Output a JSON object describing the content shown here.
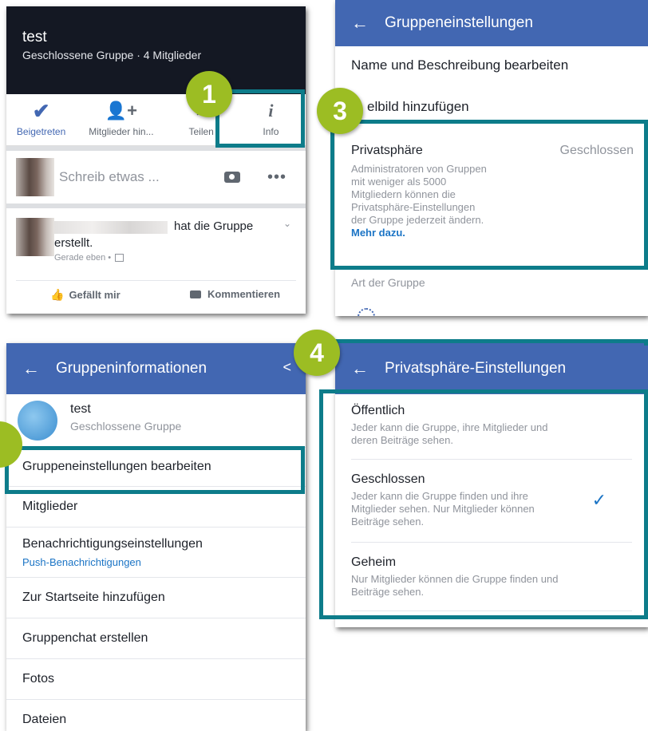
{
  "p1": {
    "group_name": "test",
    "group_sub": "Geschlossene Gruppe · 4 Mitglieder",
    "actions": [
      {
        "label": "Beigetreten",
        "icon": "checkmark-icon"
      },
      {
        "label": "Mitglieder hin...",
        "icon": "add-member-icon"
      },
      {
        "label": "Teilen",
        "icon": "share-icon"
      },
      {
        "label": "Info",
        "icon": "info-icon"
      }
    ],
    "composer_placeholder": "Schreib etwas ...",
    "post_text": "hat die Gruppe",
    "post_text2": "erstellt.",
    "post_time": "Gerade eben •",
    "like": "Gefällt mir",
    "comment": "Kommentieren"
  },
  "p2": {
    "title": "Gruppeneinstellungen",
    "item1": "Name und Beschreibung bearbeiten",
    "item2": "elbild hinzufügen",
    "privacy_label": "Privatsphäre",
    "privacy_value": "Geschlossen",
    "privacy_desc_lines": [
      "Administratoren von Gruppen",
      "mit weniger als 5000",
      "Mitgliedern können die",
      "Privatsphäre-Einstellungen",
      "der Gruppe jederzeit ändern."
    ],
    "privacy_more": "Mehr dazu.",
    "type_label": "Art der Gruppe"
  },
  "p3": {
    "title": "Gruppeninformationen",
    "group_name": "test",
    "group_sub": "Geschlossene Gruppe",
    "items": [
      {
        "label": "Gruppeneinstellungen bearbeiten"
      },
      {
        "label": "Mitglieder"
      },
      {
        "label": "Benachrichtigungseinstellungen",
        "sub": "Push-Benachrichtigungen"
      },
      {
        "label": "Zur Startseite hinzufügen"
      },
      {
        "label": "Gruppenchat erstellen"
      },
      {
        "label": "Fotos"
      },
      {
        "label": "Dateien"
      }
    ]
  },
  "p4": {
    "title": "Privatsphäre-Einstellungen",
    "options": [
      {
        "label": "Öffentlich",
        "desc_lines": [
          "Jeder kann die Gruppe, ihre Mitglieder und",
          "deren Beiträge sehen."
        ],
        "selected": false
      },
      {
        "label": "Geschlossen",
        "desc_lines": [
          "Jeder kann die Gruppe finden und ihre",
          "Mitglieder sehen. Nur Mitglieder können",
          "Beiträge sehen."
        ],
        "selected": true
      },
      {
        "label": "Geheim",
        "desc_lines": [
          "Nur Mitglieder können die Gruppe finden und",
          "Beiträge sehen."
        ],
        "selected": false
      }
    ]
  },
  "badges": {
    "b1": "1",
    "b3": "3",
    "b4": "4"
  },
  "colors": {
    "fb_blue": "#4267b2",
    "highlight": "#0d7c8a",
    "badge": "#9cbd23",
    "link": "#1b74c5"
  }
}
